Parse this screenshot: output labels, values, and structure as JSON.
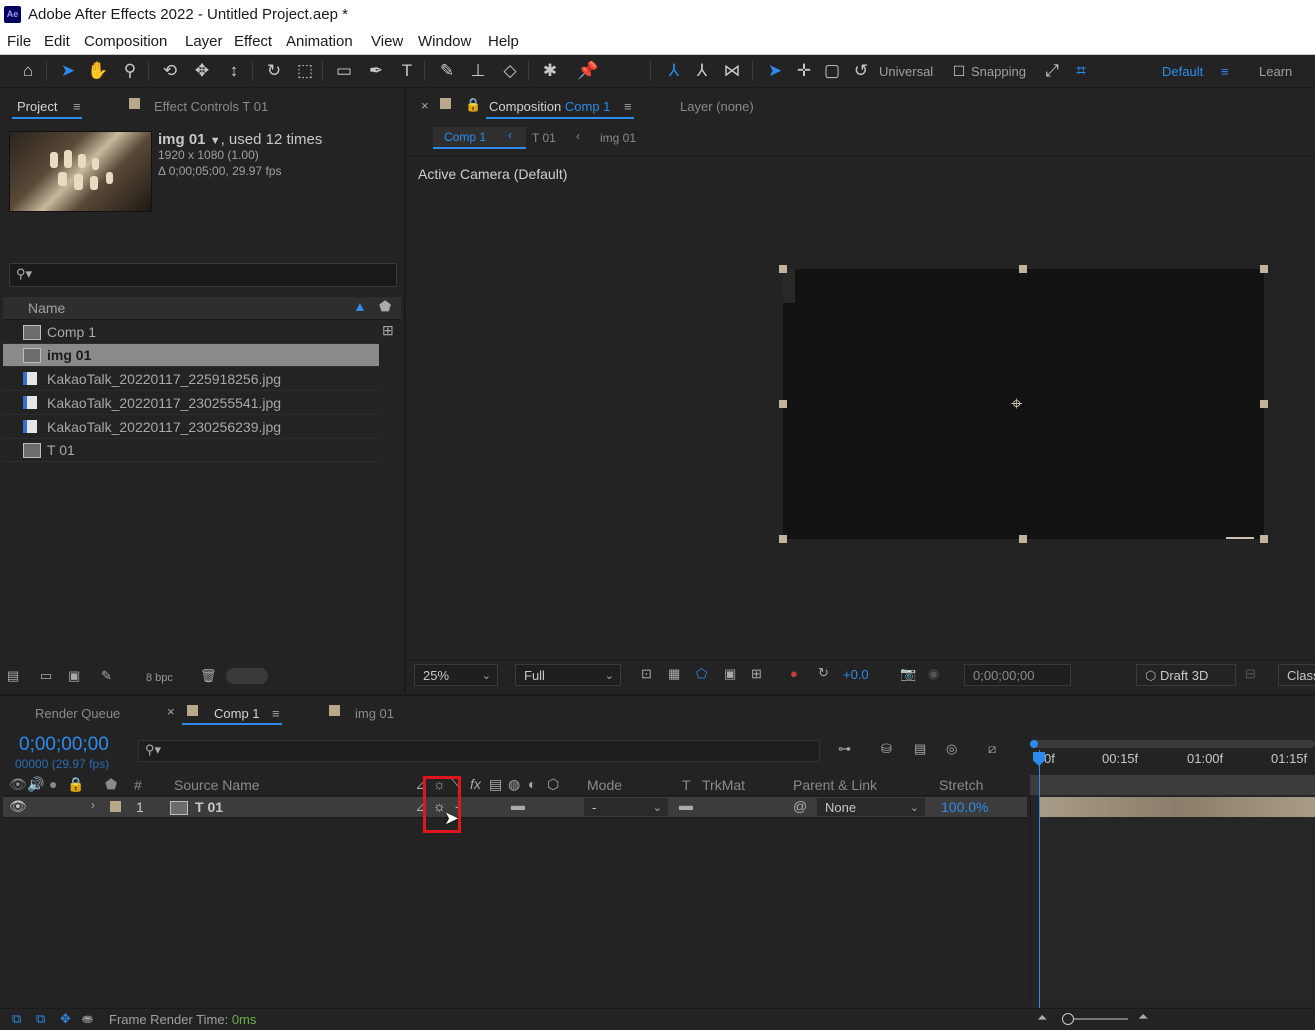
{
  "window": {
    "title": "Adobe After Effects 2022 - Untitled Project.aep *",
    "logo": "Ae"
  },
  "menu": [
    "File",
    "Edit",
    "Composition",
    "Layer",
    "Effect",
    "Animation",
    "View",
    "Window",
    "Help"
  ],
  "toolbar": {
    "universal_label": "Universal",
    "snapping_label": "Snapping",
    "workspace_default": "Default",
    "workspace_learn": "Learn",
    "icons": [
      "home-icon",
      "selection-tool-icon",
      "hand-tool-icon",
      "zoom-tool-icon",
      "orbit-camera-icon",
      "pan-camera-icon",
      "dolly-camera-icon",
      "rotation-tool-icon",
      "pan-behind-icon",
      "rectangle-tool-icon",
      "pen-tool-icon",
      "type-tool-icon",
      "brush-tool-icon",
      "clone-stamp-icon",
      "eraser-icon",
      "roto-brush-icon",
      "puppet-pin-icon"
    ]
  },
  "project_panel": {
    "tab_project": "Project",
    "tab_effect_controls": "Effect Controls",
    "tab_effect_controls_target": "T 01",
    "item_name": "img 01",
    "item_usage": ", used 12 times",
    "item_dims": "1920 x 1080 (1.00)",
    "item_duration": "Δ 0;00;05;00, 29.97 fps",
    "search_placeholder": "",
    "col_name": "Name",
    "items": [
      {
        "name": "Comp 1",
        "type": "comp",
        "selected": false
      },
      {
        "name": "img 01",
        "type": "comp",
        "selected": true
      },
      {
        "name": "KakaoTalk_20220117_225918256.jpg",
        "type": "file",
        "selected": false
      },
      {
        "name": "KakaoTalk_20220117_230255541.jpg",
        "type": "file",
        "selected": false
      },
      {
        "name": "KakaoTalk_20220117_230256239.jpg",
        "type": "file",
        "selected": false
      },
      {
        "name": "T 01",
        "type": "comp",
        "selected": false
      }
    ],
    "bpc": "8 bpc"
  },
  "comp_panel": {
    "tab_label": "Composition",
    "tab_comp": "Comp 1",
    "layer_tab": "Layer (none)",
    "breadcrumbs": [
      "Comp 1",
      "T 01",
      "img 01"
    ],
    "camera": "Active Camera (Default)",
    "zoom": "25%",
    "resolution": "Full",
    "exposure": "+0.0",
    "timecode": "0;00;00;00",
    "renderer": "Draft 3D",
    "classic": "Class"
  },
  "timeline": {
    "tab_render_queue": "Render Queue",
    "tab_comp": "Comp 1",
    "tab_img": "img 01",
    "timecode": "0;00;00;00",
    "frames": "00000 (29.97 fps)",
    "columns": {
      "num": "#",
      "source": "Source Name",
      "mode": "Mode",
      "t": "T",
      "trkmat": "TrkMat",
      "parent": "Parent & Link",
      "stretch": "Stretch"
    },
    "ruler": [
      "0f",
      "00:15f",
      "01:00f",
      "01:15f"
    ],
    "layers": [
      {
        "num": "1",
        "name": "T 01",
        "mode": "-",
        "parent": "None",
        "stretch": "100.0%"
      }
    ]
  },
  "status": {
    "label": "Frame Render Time:",
    "value": "0ms"
  }
}
